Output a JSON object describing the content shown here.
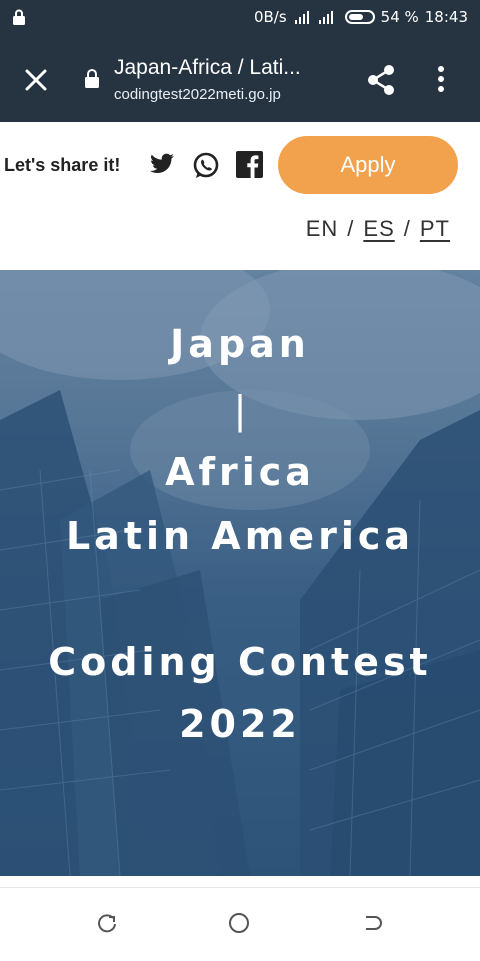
{
  "status_bar": {
    "data_rate": "0B/s",
    "battery": "54 %",
    "time": "18:43"
  },
  "browser": {
    "title": "Japan-Africa / Lati...",
    "url": "codingtest2022meti.go.jp",
    "icons": [
      "close-icon",
      "lock-icon",
      "share-icon",
      "more-vert-icon"
    ]
  },
  "header": {
    "share_label": "Let's share it!",
    "social_icons": [
      "twitter-icon",
      "whatsapp-icon",
      "facebook-icon"
    ],
    "apply_label": "Apply",
    "apply_color": "#f2a24d",
    "languages": [
      "EN",
      "ES",
      "PT"
    ],
    "separator": "/"
  },
  "hero": {
    "line1": "Japan",
    "divider": "|",
    "line2": "Africa",
    "line3": "Latin America",
    "line4": "Coding Contest",
    "line5": "2022"
  },
  "colors": {
    "toolbar": "#263442",
    "hero_overlay": "#2e5479"
  },
  "nav": {
    "icons": [
      "recent-apps-icon",
      "home-icon",
      "back-icon"
    ]
  }
}
